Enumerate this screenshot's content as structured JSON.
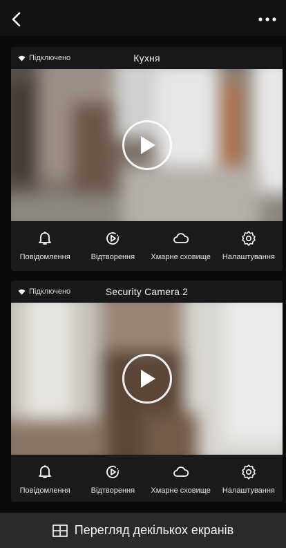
{
  "header": {
    "back_icon": "chevron-left-icon",
    "more_icon": "more-horizontal-icon"
  },
  "cameras": [
    {
      "status": "Підключено",
      "status_icon": "wifi-icon",
      "title": "Кухня",
      "play_icon": "play-icon",
      "actions": [
        {
          "label": "Повідомлення",
          "icon": "bell-icon"
        },
        {
          "label": "Відтворення",
          "icon": "playback-icon"
        },
        {
          "label": "Хмарне сховище",
          "icon": "cloud-icon"
        },
        {
          "label": "Налаштування",
          "icon": "gear-icon"
        }
      ]
    },
    {
      "status": "Підключено",
      "status_icon": "wifi-icon",
      "title": "Security Camera 2",
      "play_icon": "play-icon",
      "actions": [
        {
          "label": "Повідомлення",
          "icon": "bell-icon"
        },
        {
          "label": "Відтворення",
          "icon": "playback-icon"
        },
        {
          "label": "Хмарне сховище",
          "icon": "cloud-icon"
        },
        {
          "label": "Налаштування",
          "icon": "gear-icon"
        }
      ]
    }
  ],
  "bottom_bar": {
    "label": "Перегляд декількох екранів",
    "icon": "grid-icon"
  },
  "colors": {
    "background": "#0f0f10",
    "card": "#1b1b1d",
    "bottom_bar": "#2a2a2c",
    "text": "#eaeaea"
  }
}
